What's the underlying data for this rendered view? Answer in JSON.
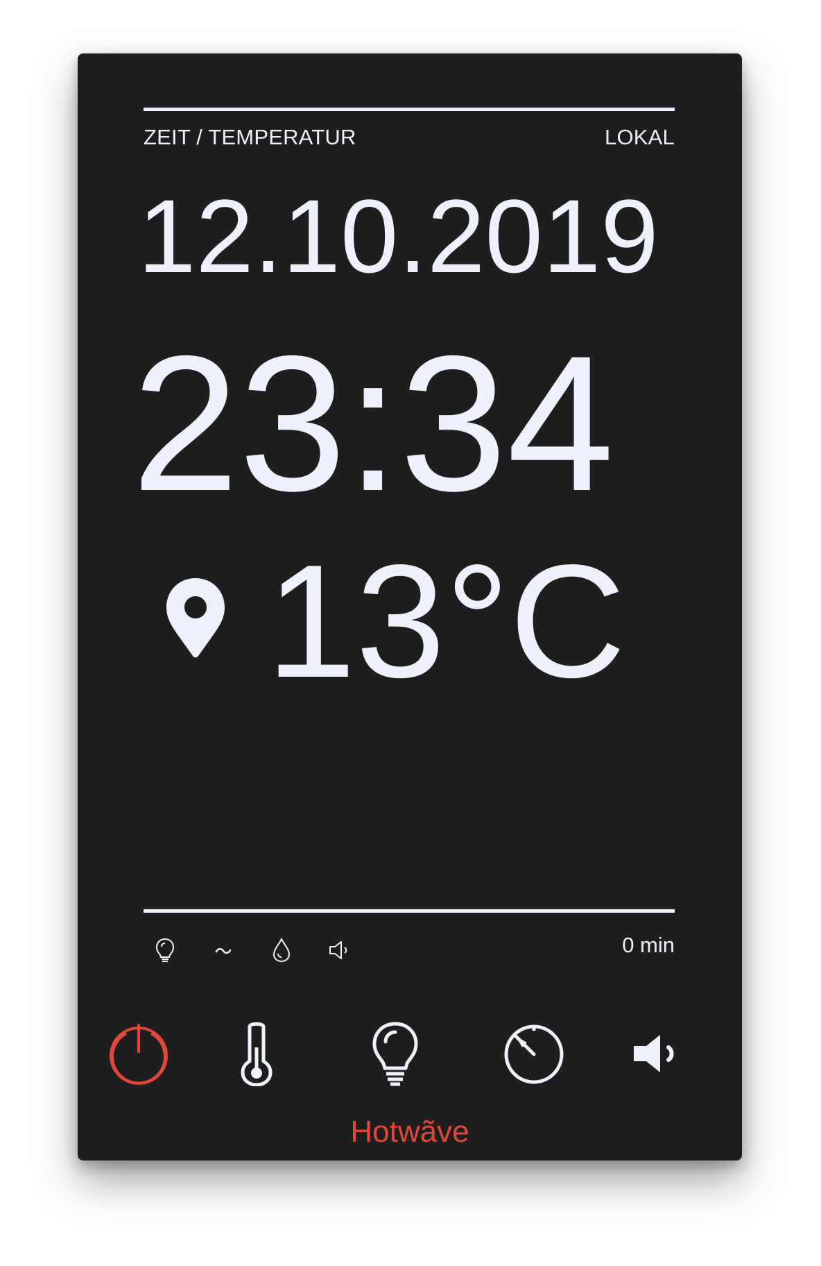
{
  "header": {
    "left_label": "ZEIT / TEMPERATUR",
    "right_label": "LOKAL"
  },
  "display": {
    "date": "12.10.2019",
    "time": "23:34",
    "temperature": "13°C",
    "location_icon": "location-pin-icon"
  },
  "status": {
    "icons": [
      "lightbulb-icon",
      "wave-icon",
      "water-drop-icon",
      "speaker-icon"
    ],
    "wave_glyph": "~",
    "minutes": "0 min"
  },
  "controls": {
    "items": [
      "power-icon",
      "thermometer-icon",
      "lightbulb-icon",
      "timer-icon",
      "volume-icon"
    ],
    "power_color": "#e0473a",
    "icon_color": "#eef1fb"
  },
  "brand": {
    "name": "Hotwãve",
    "color": "#e0473a"
  },
  "theme": {
    "panel_bg": "#1e1e1e",
    "text": "#eef1fb"
  }
}
